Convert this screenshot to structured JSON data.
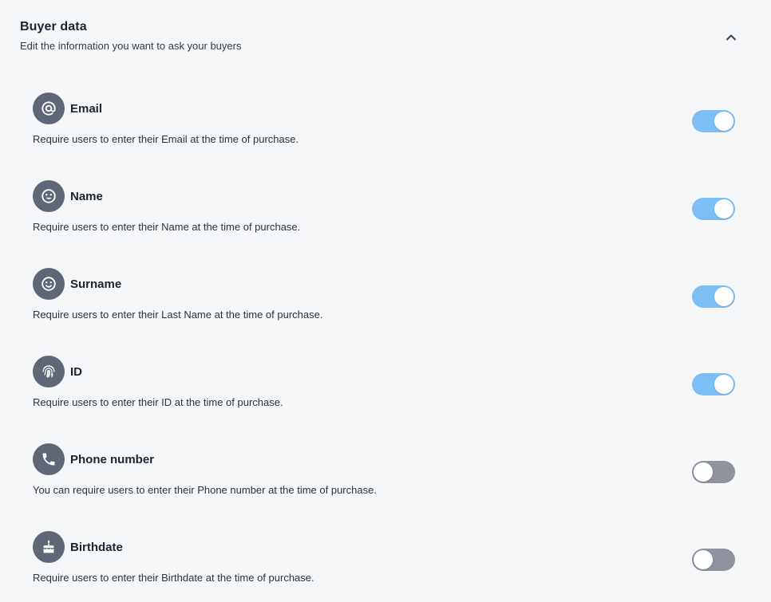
{
  "section": {
    "title": "Buyer data",
    "subtitle": "Edit the information you want to ask your buyers",
    "collapse_icon": "chevron-up-icon"
  },
  "colors": {
    "toggle_on": "#7ebef6",
    "toggle_off": "#8e939d",
    "icon_background": "#5f6675"
  },
  "fields": [
    {
      "label": "Email",
      "description": "Require users to enter their Email at the time of purchase.",
      "icon": "at-sign-icon",
      "enabled": true
    },
    {
      "label": "Name",
      "description": "Require users to enter their Name at the time of purchase.",
      "icon": "smiley-face-icon",
      "enabled": true
    },
    {
      "label": "Surname",
      "description": "Require users to enter their Last Name at the time of purchase.",
      "icon": "smiley-face-icon",
      "enabled": true
    },
    {
      "label": "ID",
      "description": "Require users to enter their ID at the time of purchase.",
      "icon": "fingerprint-icon",
      "enabled": true
    },
    {
      "label": "Phone number",
      "description": "You can require users to enter their Phone number at the time of purchase.",
      "icon": "phone-icon",
      "enabled": false
    },
    {
      "label": "Birthdate",
      "description": "Require users to enter their Birthdate at the time of purchase.",
      "icon": "birthday-cake-icon",
      "enabled": false
    }
  ]
}
